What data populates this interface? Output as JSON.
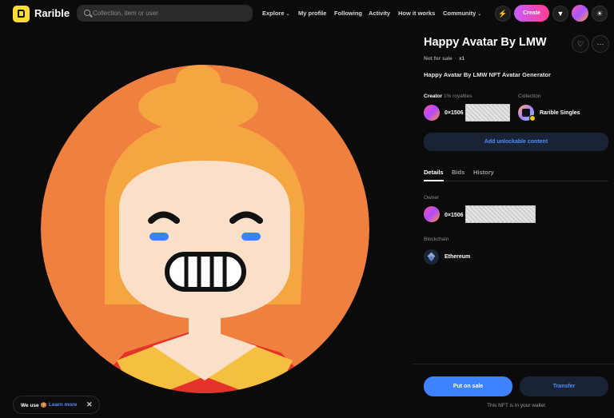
{
  "nav": {
    "brand": "Rarible",
    "search_placeholder": "Collection, item or user",
    "links": [
      "Explore",
      "My profile",
      "Following",
      "Activity",
      "How it works",
      "Community"
    ],
    "create_label": "Create"
  },
  "item": {
    "title": "Happy Avatar By LMW",
    "sale_status": "Not for sale",
    "quantity": "x1",
    "description": "Happy Avatar By LMW NFT Avatar Generator",
    "creator_label": "Creator",
    "royalties": "1% royalties",
    "creator_address": "0×1506",
    "collection_label": "Collection",
    "collection_name": "Rarible Singles",
    "unlockable_label": "Add unlockable content"
  },
  "tabs": [
    "Details",
    "Bids",
    "History"
  ],
  "details": {
    "owner_label": "Owner",
    "owner_address": "0×1506",
    "blockchain_label": "Blockchain",
    "blockchain_name": "Ethereum"
  },
  "actions": {
    "put_on_sale": "Put on sale",
    "transfer": "Transfer",
    "wallet_note": "This NFT is in your wallet"
  },
  "cookie": {
    "text": "We use 🍪",
    "link": "Learn more"
  },
  "colors": {
    "accent_blue": "#3f82ff",
    "create_gradient_start": "#c85cff",
    "create_gradient_end": "#ff3d8b",
    "art_background": "#f08040"
  }
}
